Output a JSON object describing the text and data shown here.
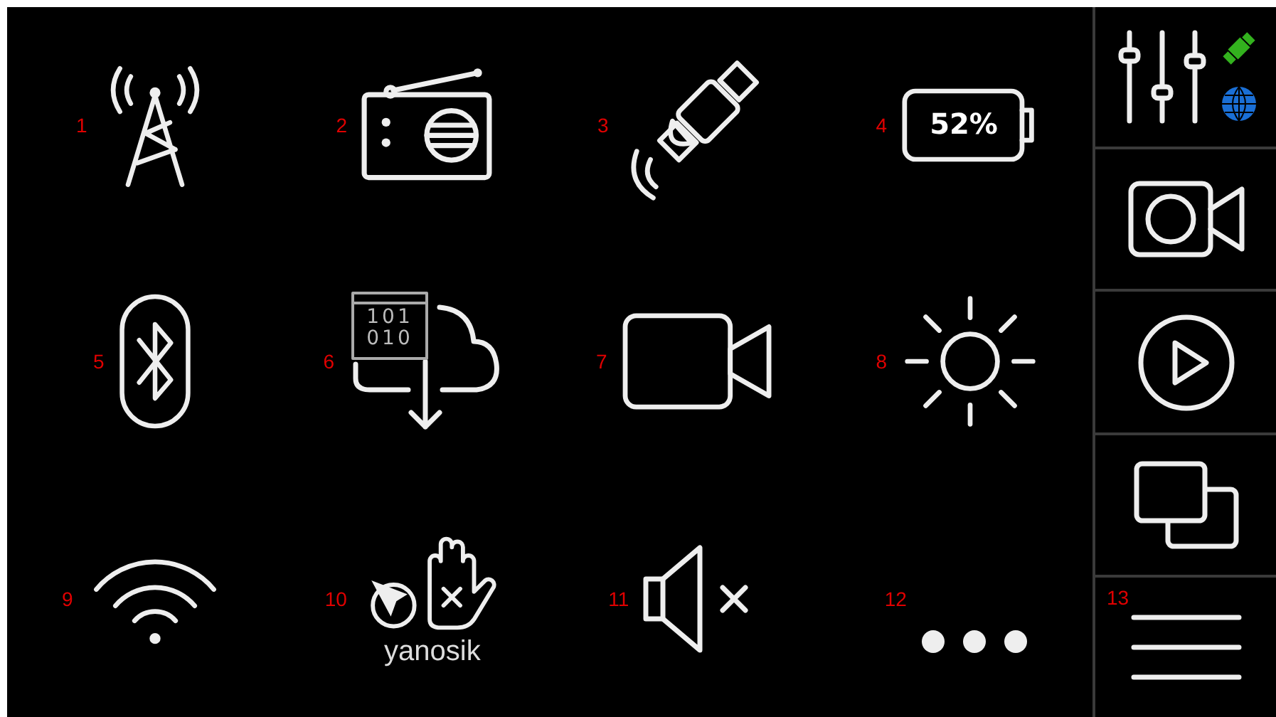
{
  "tiles": [
    {
      "number": "1",
      "kind": "tower"
    },
    {
      "number": "2",
      "kind": "radio"
    },
    {
      "number": "3",
      "kind": "satellite"
    },
    {
      "number": "4",
      "kind": "battery",
      "text": "52%"
    },
    {
      "number": "5",
      "kind": "bluetooth"
    },
    {
      "number": "6",
      "kind": "cloud-download",
      "lines": [
        "101",
        "010"
      ]
    },
    {
      "number": "7",
      "kind": "video"
    },
    {
      "number": "8",
      "kind": "brightness"
    },
    {
      "number": "9",
      "kind": "wifi"
    },
    {
      "number": "10",
      "kind": "yanosik",
      "text": "yanosik"
    },
    {
      "number": "11",
      "kind": "mute"
    },
    {
      "number": "12",
      "kind": "more"
    }
  ],
  "sidebar": [
    {
      "kind": "mixer"
    },
    {
      "kind": "camera"
    },
    {
      "kind": "play"
    },
    {
      "kind": "windows"
    },
    {
      "kind": "menu",
      "number": "13"
    }
  ]
}
